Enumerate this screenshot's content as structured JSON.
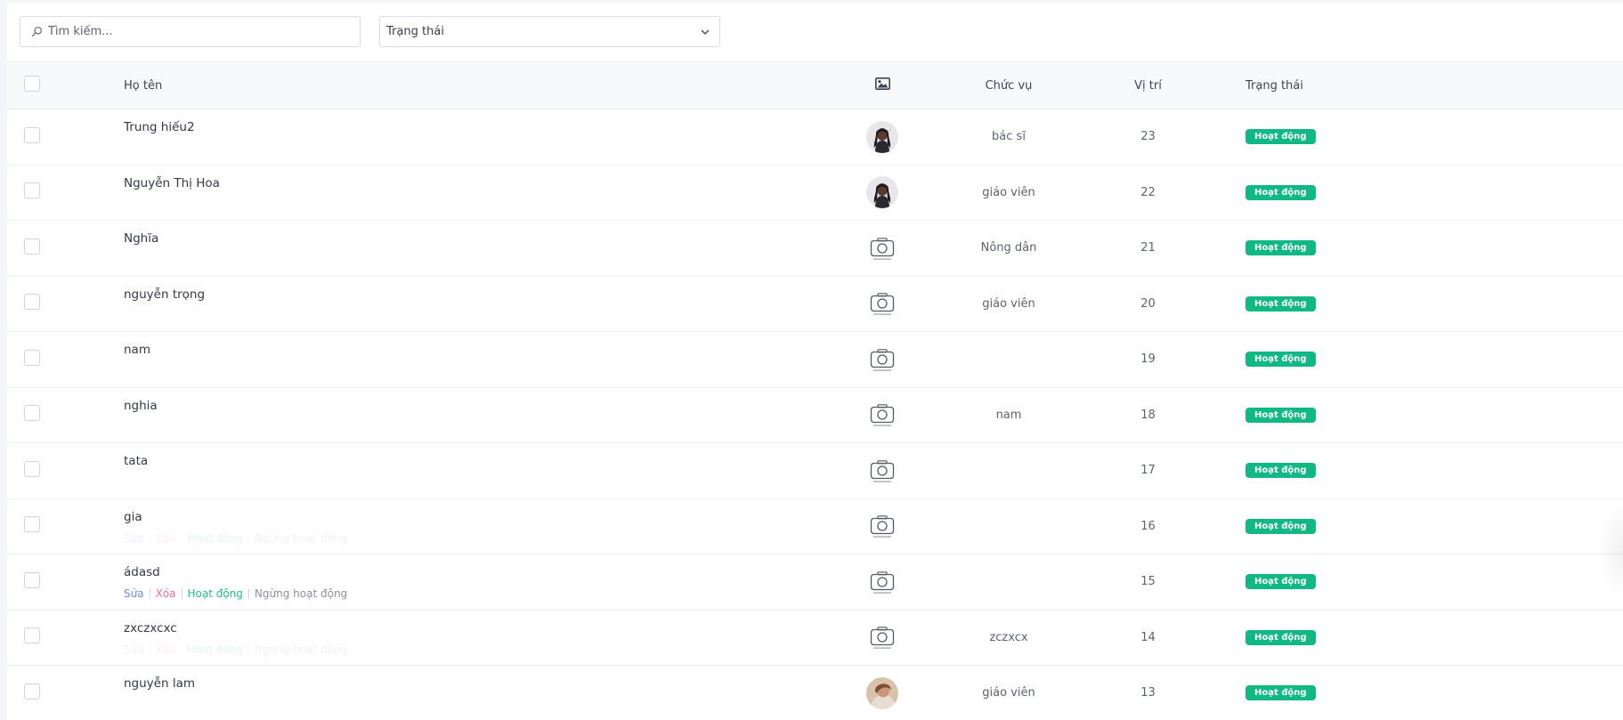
{
  "filters": {
    "search_placeholder": "Tìm kiếm...",
    "status_select_value": "Trạng thái"
  },
  "table": {
    "headers": {
      "name": "Họ tên",
      "role": "Chức vụ",
      "position": "Vị trí",
      "status": "Trạng thái"
    },
    "row_actions": {
      "edit": "Sửa",
      "delete": "Xóa",
      "activate": "Hoạt động",
      "deactivate": "Ngừng hoạt động"
    },
    "rows": [
      {
        "name": "Trung hiếu2",
        "role": "bác sĩ",
        "position": "23",
        "status": "Hoạt động",
        "image": "avatar-photo"
      },
      {
        "name": "Nguyễn Thị Hoa",
        "role": "giáo viên",
        "position": "22",
        "status": "Hoạt động",
        "image": "avatar-photo"
      },
      {
        "name": "Nghĩa",
        "role": "Nông dân",
        "position": "21",
        "status": "Hoạt động",
        "image": "no-image-camera-icon"
      },
      {
        "name": "nguyễn trọng",
        "role": "giáo viên",
        "position": "20",
        "status": "Hoạt động",
        "image": "no-image-camera-icon"
      },
      {
        "name": "nam",
        "role": "",
        "position": "19",
        "status": "Hoạt động",
        "image": "no-image-camera-icon"
      },
      {
        "name": "nghia",
        "role": "nam",
        "position": "18",
        "status": "Hoạt động",
        "image": "no-image-camera-icon"
      },
      {
        "name": "tata",
        "role": "",
        "position": "17",
        "status": "Hoạt động",
        "image": "no-image-camera-icon"
      },
      {
        "name": "gia",
        "role": "",
        "position": "16",
        "status": "Hoạt động",
        "image": "no-image-camera-icon"
      },
      {
        "name": "ádasd",
        "role": "",
        "position": "15",
        "status": "Hoạt động",
        "image": "no-image-camera-icon"
      },
      {
        "name": "zxczxcxc",
        "role": "zczxcx",
        "position": "14",
        "status": "Hoạt động",
        "image": "no-image-camera-icon"
      },
      {
        "name": "nguyễn lam",
        "role": "giáo viên",
        "position": "13",
        "status": "Hoạt động",
        "image": "avatar-photo"
      }
    ]
  },
  "colors": {
    "badge": "#10b981",
    "edit": "#6b8fe0",
    "delete": "#f0708a",
    "activate": "#1cbf8e",
    "deactivate": "#8a909b"
  }
}
